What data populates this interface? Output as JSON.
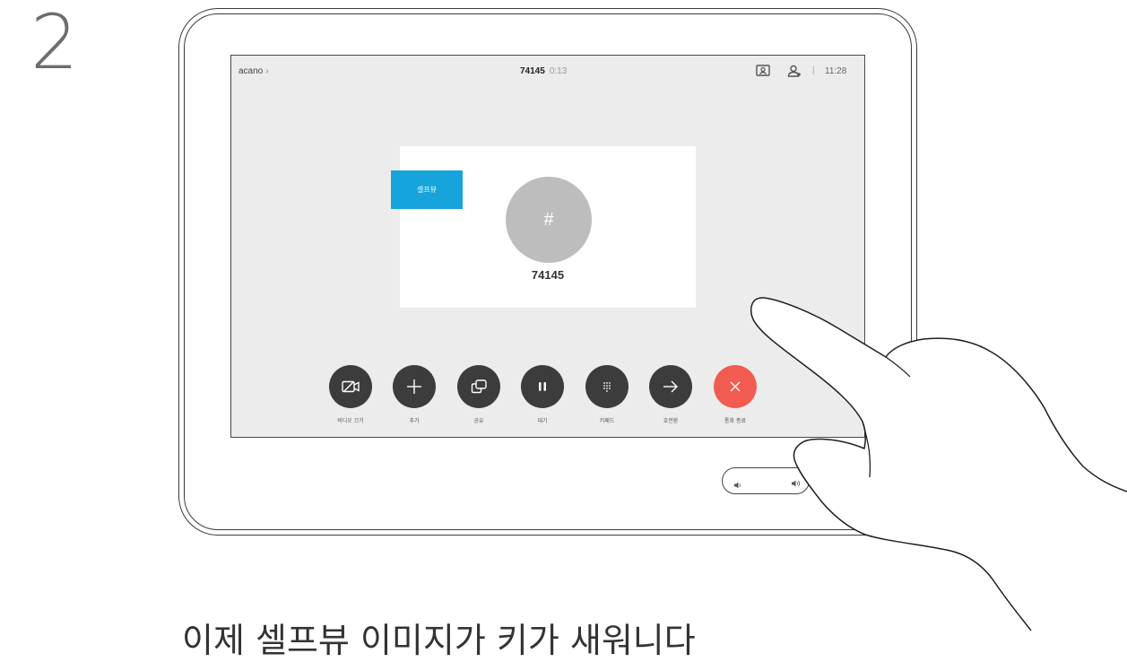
{
  "step_number": "2",
  "screen": {
    "topbar": {
      "breadcrumb": "acano",
      "breadcrumb_chevron": "›",
      "call_number": "74145",
      "call_duration": "0:13",
      "icons": [
        "selfview-toggle-icon",
        "participants-icon"
      ],
      "separator": "|",
      "clock": "11:28"
    },
    "card": {
      "avatar_symbol": "#",
      "number": "74145"
    },
    "selfview_button": "셀프뷰",
    "controls": [
      {
        "name": "video-off",
        "label": "비디오 끄기",
        "icon": "camera-off-icon"
      },
      {
        "name": "add",
        "label": "추가",
        "icon": "plus-icon"
      },
      {
        "name": "share",
        "label": "공유",
        "icon": "share-icon"
      },
      {
        "name": "hold",
        "label": "대기",
        "icon": "pause-icon"
      },
      {
        "name": "keypad",
        "label": "키패드",
        "icon": "keypad-icon"
      },
      {
        "name": "transfer",
        "label": "호전환",
        "icon": "arrow-right-icon"
      },
      {
        "name": "end-call",
        "label": "통화 종료",
        "icon": "close-icon"
      }
    ],
    "colors": {
      "screen_bg": "#ececec",
      "button_dark": "#3c3c3c",
      "end_call": "#f25b50",
      "selfview_accent": "#17a3db"
    }
  },
  "volume": {
    "down_icon": "volume-down-icon",
    "up_icon": "volume-up-icon"
  },
  "caption": "이제 셀프뷰 이미지가 키가 새워니다"
}
